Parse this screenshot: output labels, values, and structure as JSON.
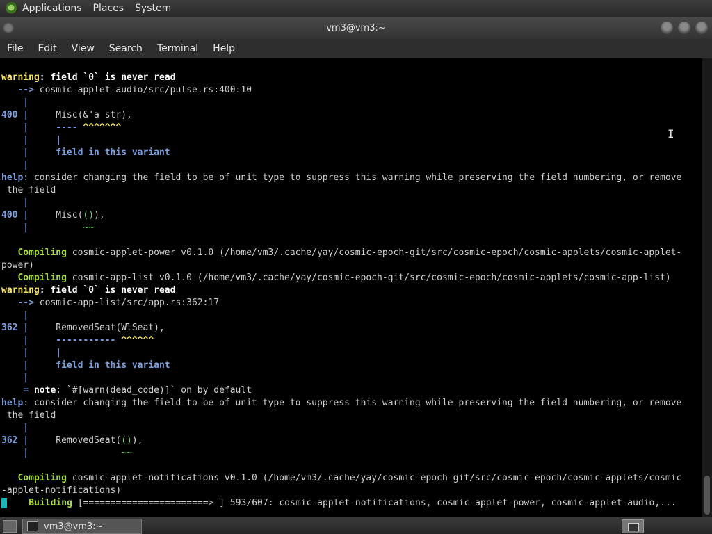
{
  "top_panel": {
    "menus": [
      "Applications",
      "Places",
      "System"
    ]
  },
  "window": {
    "title": "vm3@vm3:~"
  },
  "menubar": {
    "items": [
      "File",
      "Edit",
      "View",
      "Search",
      "Terminal",
      "Help"
    ]
  },
  "terminal": {
    "l1": {
      "a": "warning",
      "b": ": field `0` is never read"
    },
    "l2": {
      "a": "   --> ",
      "b": "cosmic-applet-audio/src/pulse.rs:400:10"
    },
    "l3": {
      "a": "    |"
    },
    "l4": {
      "a": "400 |",
      "b": "     Misc(&'a str),"
    },
    "l5": {
      "a": "    |",
      "b": "     ---- ",
      "c": "^^^^^^^"
    },
    "l6": {
      "a": "    |",
      "b": "     |"
    },
    "l7": {
      "a": "    |",
      "b": "     field in this variant"
    },
    "l8": {
      "a": "    |"
    },
    "l9": {
      "a": "help",
      "b": ": consider changing the field to be of unit type to suppress this warning while preserving the field numbering, or remove"
    },
    "l10": {
      "a": " the field"
    },
    "l11": {
      "a": "    |"
    },
    "l12": {
      "a": "400 |",
      "b": "     Misc(",
      "c": "()",
      "d": "),"
    },
    "l13": {
      "a": "    |",
      "b": "          ~~"
    },
    "l14": {
      "a": "   Compiling",
      "b": " cosmic-applet-power v0.1.0 (/home/vm3/.cache/yay/cosmic-epoch-git/src/cosmic-epoch/cosmic-applets/cosmic-applet-"
    },
    "l15": {
      "a": "power)"
    },
    "l16": {
      "a": "   Compiling",
      "b": " cosmic-app-list v0.1.0 (/home/vm3/.cache/yay/cosmic-epoch-git/src/cosmic-epoch/cosmic-applets/cosmic-app-list)"
    },
    "l17": {
      "a": "warning",
      "b": ": field `0` is never read"
    },
    "l18": {
      "a": "   --> ",
      "b": "cosmic-app-list/src/app.rs:362:17"
    },
    "l19": {
      "a": "    |"
    },
    "l20": {
      "a": "362 |",
      "b": "     RemovedSeat(WlSeat),"
    },
    "l21": {
      "a": "    |",
      "b": "     ----------- ",
      "c": "^^^^^^"
    },
    "l22": {
      "a": "    |",
      "b": "     |"
    },
    "l23": {
      "a": "    |",
      "b": "     field in this variant"
    },
    "l24": {
      "a": "    |"
    },
    "l25": {
      "a": "    = ",
      "b": "note",
      "c": ": `#[warn(dead_code)]` on by default"
    },
    "l26": {
      "a": "help",
      "b": ": consider changing the field to be of unit type to suppress this warning while preserving the field numbering, or remove"
    },
    "l27": {
      "a": " the field"
    },
    "l28": {
      "a": "    |"
    },
    "l29": {
      "a": "362 |",
      "b": "     RemovedSeat(",
      "c": "()",
      "d": "),"
    },
    "l30": {
      "a": "    |",
      "b": "                 ~~"
    },
    "l31": {
      "a": "   Compiling",
      "b": " cosmic-applet-notifications v0.1.0 (/home/vm3/.cache/yay/cosmic-epoch-git/src/cosmic-epoch/cosmic-applets/cosmic"
    },
    "l32": {
      "a": "-applet-notifications)"
    },
    "l33": {
      "a": "    Building",
      "b": " [=======================> ] 593/607: cosmic-applet-notifications, cosmic-applet-power, cosmic-applet-audio,..."
    }
  },
  "taskbar": {
    "item_label": "vm3@vm3:~"
  },
  "colors": {
    "warning": "#f5e35a",
    "compiling": "#a8dd3a",
    "help_gutter": "#7c9fe0",
    "background": "#000000"
  }
}
